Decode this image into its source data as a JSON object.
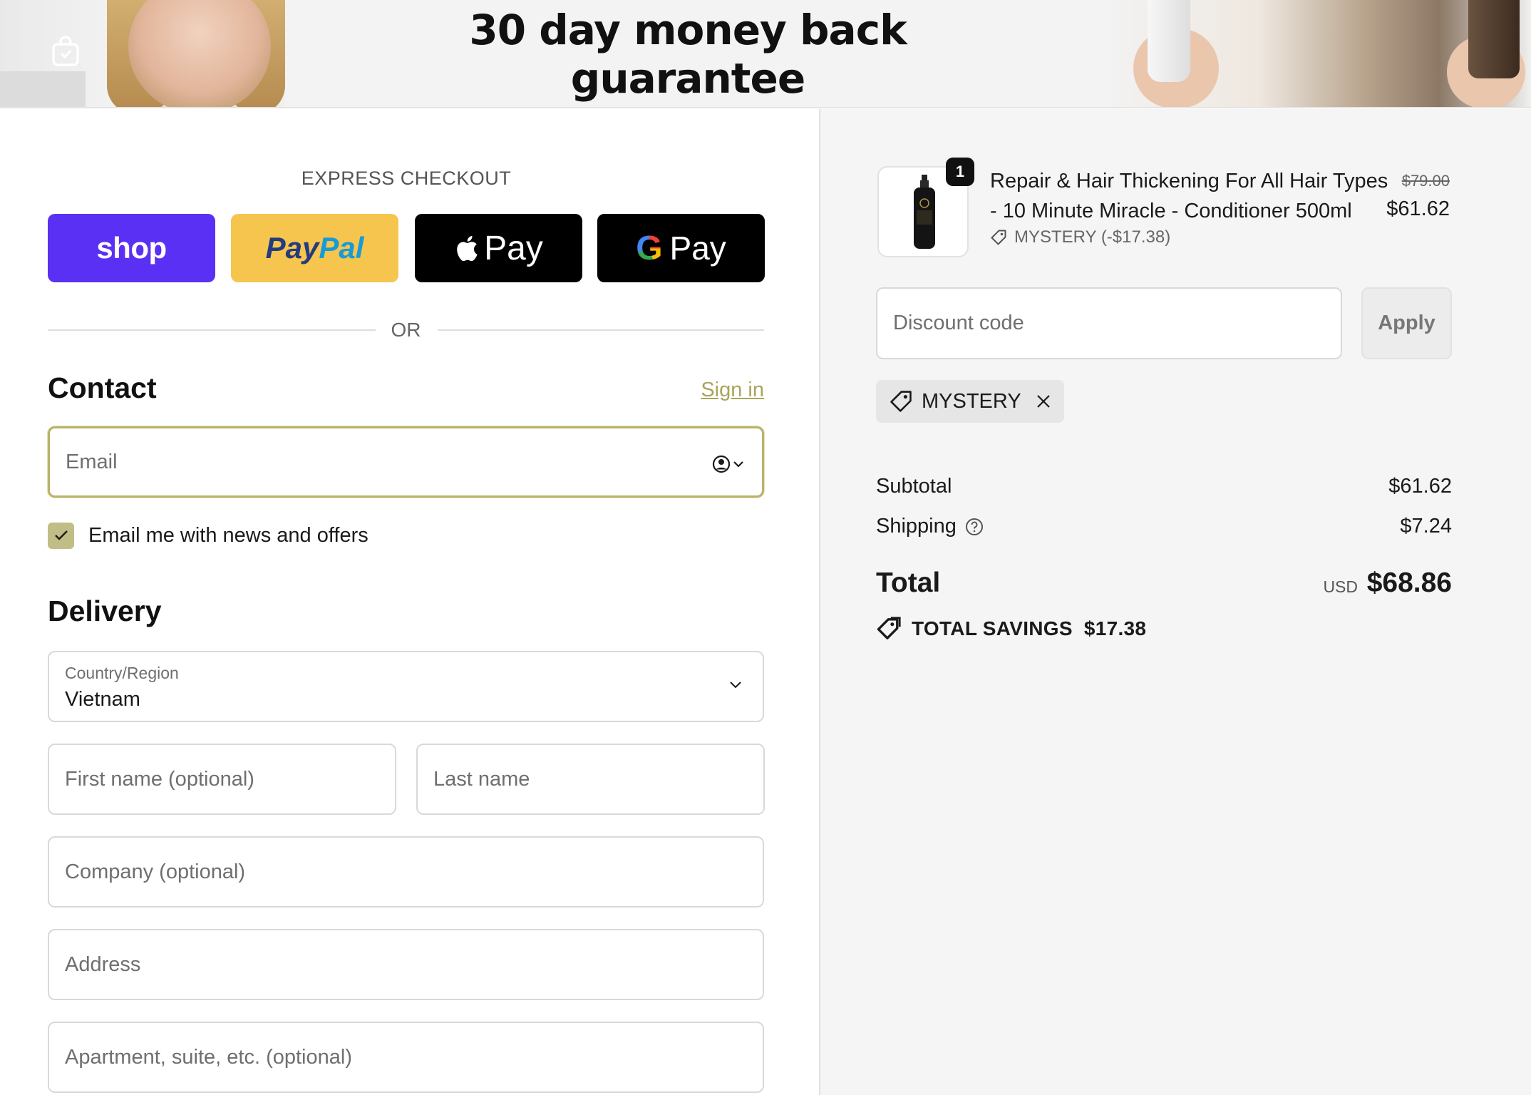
{
  "banner": {
    "title_line1": "30 day money back",
    "title_line2": "guarantee"
  },
  "express": {
    "label": "EXPRESS CHECKOUT",
    "shop_label": "shop",
    "paypal_label_a": "Pay",
    "paypal_label_b": "Pal",
    "apple_pay_label": "Pay",
    "google_pay_label": "Pay",
    "or_label": "OR"
  },
  "contact": {
    "title": "Contact",
    "sign_in_label": "Sign in",
    "email_placeholder": "Email",
    "newsletter_label": "Email me with news and offers",
    "newsletter_checked": true
  },
  "delivery": {
    "title": "Delivery",
    "country_label": "Country/Region",
    "country_value": "Vietnam",
    "first_name_placeholder": "First name (optional)",
    "last_name_placeholder": "Last name",
    "company_placeholder": "Company (optional)",
    "address_placeholder": "Address",
    "apartment_placeholder": "Apartment, suite, etc. (optional)"
  },
  "order": {
    "item": {
      "quantity": "1",
      "title": "Repair & Hair Thickening For All Hair Types - 10 Minute Miracle - Conditioner 500ml",
      "discount": "MYSTERY (-$17.38)",
      "price_original": "$79.00",
      "price_current": "$61.62"
    },
    "discount_placeholder": "Discount code",
    "apply_label": "Apply",
    "applied_code": "MYSTERY",
    "subtotal_label": "Subtotal",
    "subtotal_value": "$61.62",
    "shipping_label": "Shipping",
    "shipping_value": "$7.24",
    "total_label": "Total",
    "total_currency": "USD",
    "total_value": "$68.86",
    "savings_label": "TOTAL SAVINGS",
    "savings_value": "$17.38"
  },
  "colors": {
    "shop_purple": "#5a31f4",
    "paypal_yellow": "#f6c54d",
    "accent_olive": "#b9b36a",
    "checkbox_fill": "#c1bd86",
    "summary_bg": "#f5f5f5"
  }
}
